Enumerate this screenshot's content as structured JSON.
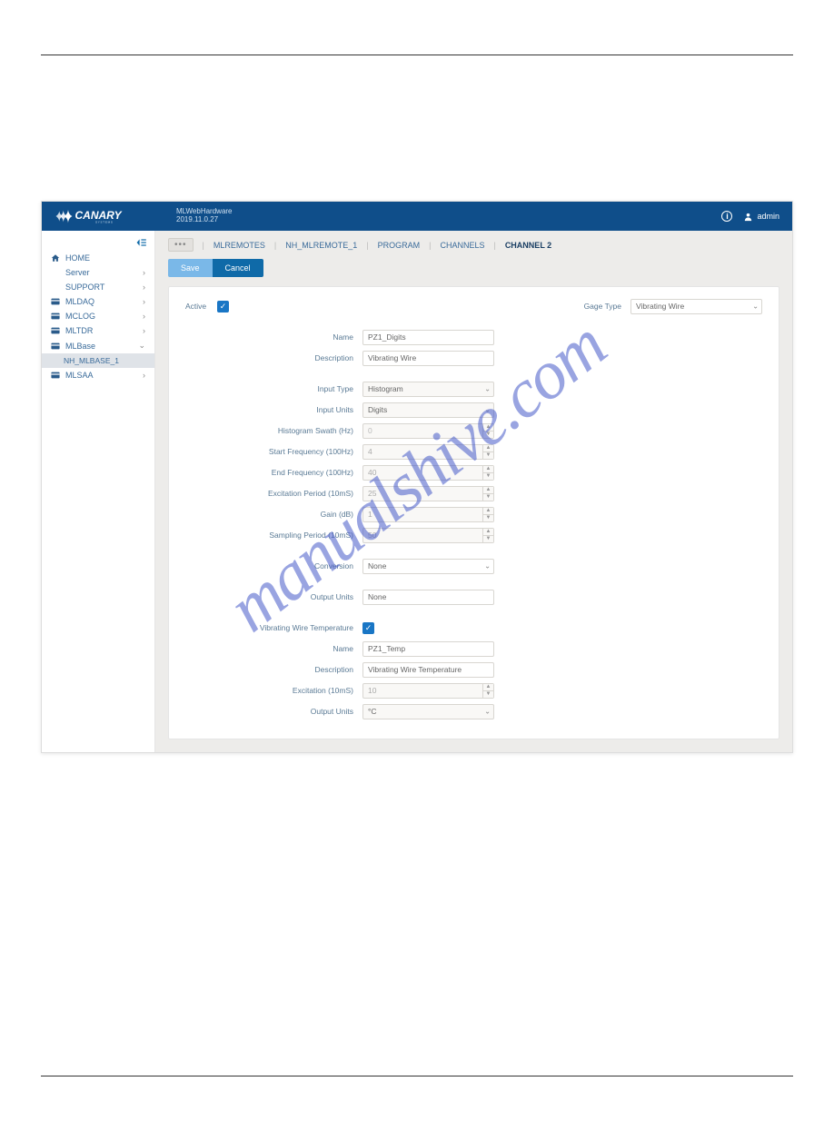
{
  "header": {
    "app_name": "MLWebHardware",
    "version": "2019.11.0.27",
    "user": "admin"
  },
  "sidebar": {
    "items": [
      {
        "label": "HOME",
        "icon": "home",
        "caret": ""
      },
      {
        "label": "Server",
        "icon": "",
        "caret": "›"
      },
      {
        "label": "SUPPORT",
        "icon": "",
        "caret": "›"
      },
      {
        "label": "MLDAQ",
        "icon": "card",
        "caret": "›"
      },
      {
        "label": "MCLOG",
        "icon": "card",
        "caret": "›"
      },
      {
        "label": "MLTDR",
        "icon": "card",
        "caret": "›"
      },
      {
        "label": "MLBase",
        "icon": "card",
        "caret": "⌄"
      },
      {
        "label": "MLSAA",
        "icon": "card",
        "caret": "›"
      }
    ],
    "sub_item": "NH_MLBASE_1"
  },
  "breadcrumb": {
    "items": [
      "MLREMOTES",
      "NH_MLREMOTE_1",
      "PROGRAM",
      "CHANNELS"
    ],
    "active": "CHANNEL 2"
  },
  "buttons": {
    "save": "Save",
    "cancel": "Cancel"
  },
  "form": {
    "active_label": "Active",
    "gage_type_label": "Gage Type",
    "gage_type_value": "Vibrating Wire",
    "name_label": "Name",
    "name_value": "PZ1_Digits",
    "description_label": "Description",
    "description_value": "Vibrating Wire",
    "input_type_label": "Input Type",
    "input_type_value": "Histogram",
    "input_units_label": "Input Units",
    "input_units_value": "Digits",
    "hist_swath_label": "Histogram Swath (Hz)",
    "hist_swath_value": "0",
    "start_freq_label": "Start Frequency (100Hz)",
    "start_freq_value": "4",
    "end_freq_label": "End Frequency (100Hz)",
    "end_freq_value": "40",
    "excite_period_label": "Excitation Period (10mS)",
    "excite_period_value": "25",
    "gain_label": "Gain (dB)",
    "gain_value": "1",
    "sampling_label": "Sampling Period (10mS)",
    "sampling_value": "50",
    "conversion_label": "Conversion",
    "conversion_value": "None",
    "output_units_label": "Output Units",
    "output_units_value": "None",
    "vw_temp_label": "Vibrating Wire Temperature",
    "t_name_label": "Name",
    "t_name_value": "PZ1_Temp",
    "t_desc_label": "Description",
    "t_desc_value": "Vibrating Wire Temperature",
    "t_excite_label": "Excitation (10mS)",
    "t_excite_value": "10",
    "t_output_units_label": "Output Units",
    "t_output_units_value": "°C"
  },
  "watermark": "manualshive.com"
}
